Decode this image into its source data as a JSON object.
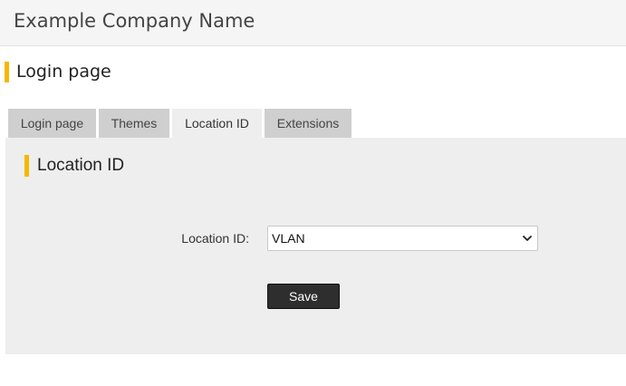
{
  "header": {
    "company_name": "Example Company Name"
  },
  "page": {
    "title": "Login page"
  },
  "tabs": [
    {
      "label": "Login page",
      "active": false
    },
    {
      "label": "Themes",
      "active": false
    },
    {
      "label": "Location ID",
      "active": true
    },
    {
      "label": "Extensions",
      "active": false
    }
  ],
  "section": {
    "title": "Location ID",
    "field_label": "Location ID:",
    "select_value": "VLAN",
    "save_label": "Save"
  },
  "colors": {
    "accent": "#f5b800",
    "tab_inactive": "#cfcfcf",
    "tab_active": "#eeeeee",
    "button": "#2e2e2e"
  },
  "icons": {
    "select_indicator": "chevron-down-icon"
  }
}
